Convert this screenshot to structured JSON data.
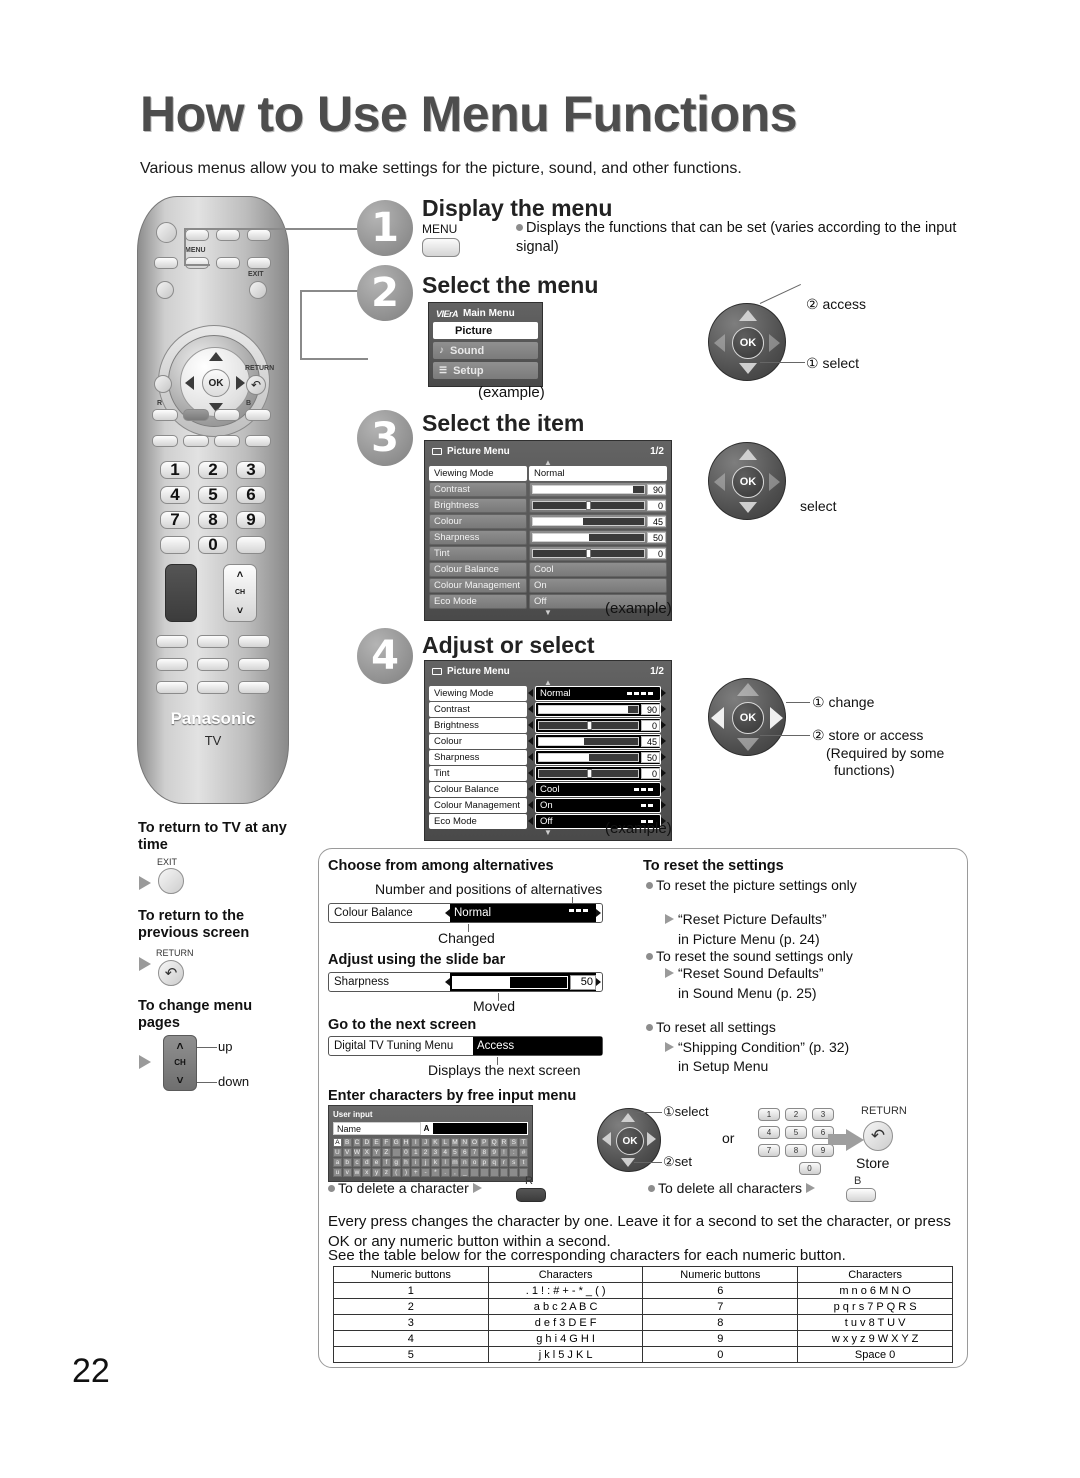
{
  "page": {
    "title": "How to Use Menu Functions",
    "intro": "Various menus allow you to make settings for the picture, sound, and other functions.",
    "number": "22"
  },
  "remote": {
    "brand": "Panasonic",
    "sub": "TV",
    "menu_label": "MENU",
    "exit_label": "EXIT",
    "return_label": "RETURN",
    "r_label": "R",
    "b_label": "B",
    "ok_label": "OK",
    "ch_label": "CH",
    "numbers": [
      "1",
      "2",
      "3",
      "4",
      "5",
      "6",
      "7",
      "8",
      "9",
      "0"
    ]
  },
  "steps": [
    {
      "num": "1",
      "heading": "Display the menu",
      "button_label": "MENU",
      "note": "Displays the functions that can be set (varies according to the input signal)"
    },
    {
      "num": "2",
      "heading": "Select the menu",
      "example_caption": "(example)",
      "annotations": [
        {
          "order": "②",
          "text": "access"
        },
        {
          "order": "①",
          "text": "select"
        }
      ]
    },
    {
      "num": "3",
      "heading": "Select the item",
      "example_caption": "(example)",
      "annotations": [
        {
          "order": "",
          "text": "select"
        }
      ]
    },
    {
      "num": "4",
      "heading": "Adjust or select",
      "example_caption": "(example)",
      "annotations": [
        {
          "order": "①",
          "text": "change"
        },
        {
          "order": "②",
          "text": "store or access"
        },
        {
          "order": "",
          "text": "(Required by some"
        },
        {
          "order": "",
          "text": "functions)"
        }
      ]
    }
  ],
  "main_menu": {
    "brand": "VIErA",
    "title": "Main Menu",
    "items": [
      {
        "label": "Picture",
        "icon": "picture-icon",
        "selected": true
      },
      {
        "label": "Sound",
        "icon": "note-icon",
        "selected": false
      },
      {
        "label": "Setup",
        "icon": "list-icon",
        "selected": false
      }
    ]
  },
  "picture_menu": {
    "title": "Picture Menu",
    "page": "1/2",
    "rows": [
      {
        "label": "Viewing Mode",
        "value": "Normal",
        "type": "choice",
        "dots": 4,
        "active": 4
      },
      {
        "label": "Contrast",
        "value": "90",
        "type": "slider",
        "percent": 90
      },
      {
        "label": "Brightness",
        "value": "0",
        "type": "slider",
        "percent": 50
      },
      {
        "label": "Colour",
        "value": "45",
        "type": "slider",
        "percent": 45
      },
      {
        "label": "Sharpness",
        "value": "50",
        "type": "slider",
        "percent": 50
      },
      {
        "label": "Tint",
        "value": "0",
        "type": "slider",
        "percent": 50
      },
      {
        "label": "Colour Balance",
        "value": "Cool",
        "type": "choice",
        "dots": 3,
        "active": 1
      },
      {
        "label": "Colour Management",
        "value": "On",
        "type": "choice",
        "dots": 2,
        "active": 1
      },
      {
        "label": "Eco Mode",
        "value": "Off",
        "type": "choice",
        "dots": 2,
        "active": 1
      }
    ]
  },
  "side_notes": [
    {
      "heading": "To return to TV at any time",
      "button": "EXIT",
      "icon": "exit-button-icon"
    },
    {
      "heading": "To return to the previous screen",
      "button": "RETURN",
      "icon": "return-button-icon"
    },
    {
      "heading": "To change menu pages",
      "button": "CH",
      "up": "up",
      "down": "down",
      "icon": "ch-rocker-icon"
    }
  ],
  "panel": {
    "alternatives": {
      "heading": "Choose from among alternatives",
      "caption_top": "Number and positions of alternatives",
      "caption_bottom": "Changed",
      "bar_label": "Colour Balance",
      "bar_value": "Normal"
    },
    "slidebar": {
      "heading": "Adjust using the slide bar",
      "caption_bottom": "Moved",
      "bar_label": "Sharpness",
      "bar_value": "50"
    },
    "next_screen": {
      "heading": "Go to the next screen",
      "caption_bottom": "Displays the next screen",
      "bar_label": "Digital TV Tuning Menu",
      "bar_value": "Access"
    },
    "free_input": {
      "heading": "Enter characters by free input menu",
      "osd_title": "User input",
      "field_label": "Name",
      "field_char": "A",
      "keyboard_rows": [
        [
          "A",
          "B",
          "C",
          "D",
          "E",
          "F",
          "G",
          "H",
          "I",
          "J",
          "K",
          "L",
          "M",
          "N",
          "O",
          "P",
          "Q",
          "R",
          "S",
          "T"
        ],
        [
          "U",
          "V",
          "W",
          "X",
          "Y",
          "Z",
          "",
          "0",
          "1",
          "2",
          "3",
          "4",
          "5",
          "6",
          "7",
          "8",
          "9",
          "!",
          ":",
          "#"
        ],
        [
          "a",
          "b",
          "c",
          "d",
          "e",
          "f",
          "g",
          "h",
          "i",
          "j",
          "k",
          "l",
          "m",
          "n",
          "o",
          "p",
          "q",
          "r",
          "s",
          "t"
        ],
        [
          "u",
          "v",
          "w",
          "x",
          "y",
          "z",
          "(",
          ")",
          "+",
          "-",
          "*",
          ".",
          ",",
          "_",
          "",
          "",
          "",
          "",
          "",
          ""
        ]
      ],
      "annotations": [
        {
          "order": "①",
          "text": "select"
        },
        {
          "order": "②",
          "text": "set"
        }
      ],
      "or_label": "or",
      "return_label": "RETURN",
      "store_label": "Store",
      "delete_one": "To delete a character",
      "delete_one_key": "R",
      "delete_all": "To delete all characters",
      "delete_all_key": "B"
    },
    "reset": {
      "heading": "To reset the settings",
      "items": [
        {
          "bullet": "To reset the picture settings only",
          "sub1": "“Reset Picture Defaults”",
          "sub2": "in Picture Menu (p. 24)"
        },
        {
          "bullet": "To reset the sound settings only",
          "sub1": "“Reset Sound Defaults”",
          "sub2": "in Sound Menu (p. 25)"
        },
        {
          "bullet": "To reset all settings",
          "sub1": "“Shipping Condition” (p. 32)",
          "sub2": "in Setup Menu"
        }
      ]
    },
    "footer_text_1": "Every press changes the character by one. Leave it for a second to set the character, or press OK or any numeric button within a second.",
    "footer_text_2": "See the table below for the corresponding characters for each numeric button."
  },
  "char_table": {
    "headers": [
      "Numeric buttons",
      "Characters",
      "Numeric buttons",
      "Characters"
    ],
    "rows": [
      [
        "1",
        ". 1 ! : # + - * _ ( )",
        "6",
        "m n o 6 M N O"
      ],
      [
        "2",
        "a b c 2 A B C",
        "7",
        "p q r s 7 P Q R S"
      ],
      [
        "3",
        "d e f 3 D E F",
        "8",
        "t u v 8 T U V"
      ],
      [
        "4",
        "g h i 4 G H I",
        "9",
        "w x y z 9 W X Y Z"
      ],
      [
        "5",
        "j k l 5 J K L",
        "0",
        "Space 0"
      ]
    ]
  }
}
